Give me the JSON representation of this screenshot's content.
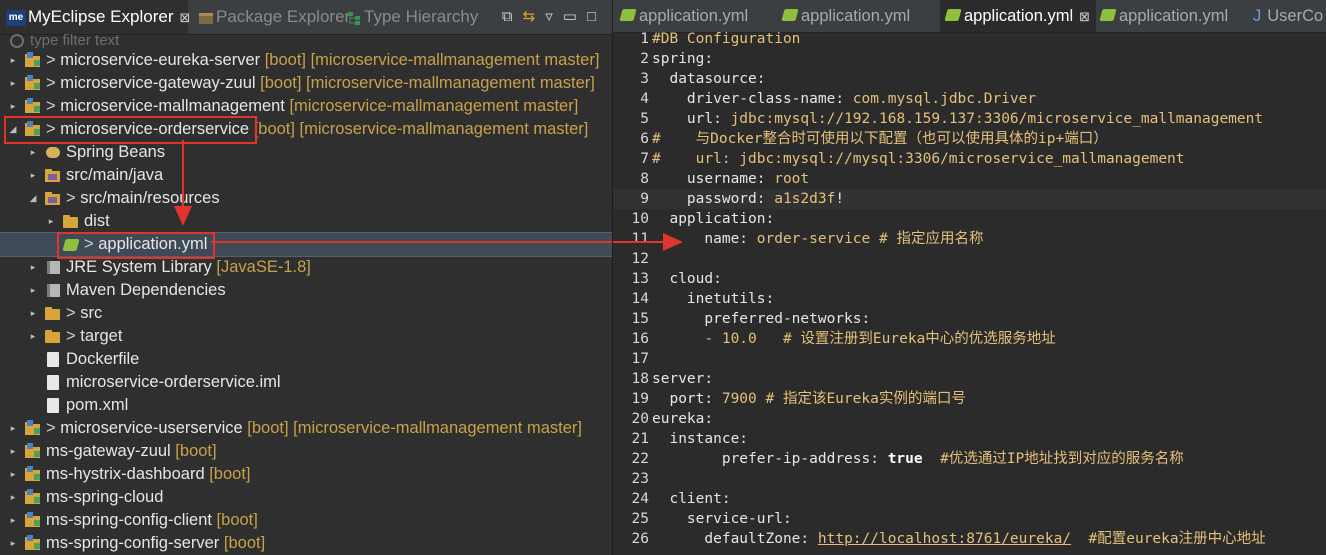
{
  "explorer": {
    "tabs": [
      {
        "label": "MyEclipse Explorer",
        "active": true,
        "icon": "myeclipse-icon",
        "close": "⊠"
      },
      {
        "label": "Package Explorer",
        "active": false,
        "icon": "package-icon"
      },
      {
        "label": "Type Hierarchy",
        "active": false,
        "icon": "hierarchy-icon"
      }
    ],
    "filter_placeholder": "type filter text",
    "rows": [
      {
        "indent": 0,
        "arrow": "▸",
        "icon": "project",
        "prefix": "> ",
        "label": "microservice-eureka-server",
        "deco": " [boot] [microservice-mallmanagement master]"
      },
      {
        "indent": 0,
        "arrow": "▸",
        "icon": "project",
        "prefix": "> ",
        "label": "microservice-gateway-zuul",
        "deco": " [boot] [microservice-mallmanagement master]"
      },
      {
        "indent": 0,
        "arrow": "▸",
        "icon": "project",
        "prefix": "> ",
        "label": "microservice-mallmanagement",
        "deco": " [microservice-mallmanagement master]"
      },
      {
        "indent": 0,
        "arrow": "◢",
        "icon": "project",
        "prefix": "> ",
        "label": "microservice-orderservice",
        "deco": " [boot] [microservice-mallmanagement master]"
      },
      {
        "indent": 1,
        "arrow": "▸",
        "icon": "bean",
        "prefix": "",
        "label": "Spring Beans",
        "deco": ""
      },
      {
        "indent": 1,
        "arrow": "▸",
        "icon": "package",
        "prefix": "",
        "label": "src/main/java",
        "deco": ""
      },
      {
        "indent": 1,
        "arrow": "◢",
        "icon": "package",
        "prefix": "> ",
        "label": "src/main/resources",
        "deco": ""
      },
      {
        "indent": 2,
        "arrow": "▸",
        "icon": "folder",
        "prefix": "",
        "label": "dist",
        "deco": ""
      },
      {
        "indent": 2,
        "arrow": "",
        "icon": "yml",
        "prefix": "> ",
        "label": "application.yml",
        "deco": "",
        "selected": true
      },
      {
        "indent": 1,
        "arrow": "▸",
        "icon": "library",
        "prefix": "",
        "label": "JRE System Library",
        "deco": " [JavaSE-1.8]"
      },
      {
        "indent": 1,
        "arrow": "▸",
        "icon": "library",
        "prefix": "",
        "label": "Maven Dependencies",
        "deco": ""
      },
      {
        "indent": 1,
        "arrow": "▸",
        "icon": "folder",
        "prefix": "> ",
        "label": "src",
        "deco": ""
      },
      {
        "indent": 1,
        "arrow": "▸",
        "icon": "folder",
        "prefix": "> ",
        "label": "target",
        "deco": ""
      },
      {
        "indent": 1,
        "arrow": "",
        "icon": "file",
        "prefix": "",
        "label": "Dockerfile",
        "deco": ""
      },
      {
        "indent": 1,
        "arrow": "",
        "icon": "file",
        "prefix": "",
        "label": "microservice-orderservice.iml",
        "deco": ""
      },
      {
        "indent": 1,
        "arrow": "",
        "icon": "file",
        "prefix": "",
        "label": "pom.xml",
        "deco": ""
      },
      {
        "indent": 0,
        "arrow": "▸",
        "icon": "project",
        "prefix": "> ",
        "label": "microservice-userservice",
        "deco": " [boot] [microservice-mallmanagement master]"
      },
      {
        "indent": 0,
        "arrow": "▸",
        "icon": "project",
        "prefix": "",
        "label": "ms-gateway-zuul",
        "deco": " [boot]"
      },
      {
        "indent": 0,
        "arrow": "▸",
        "icon": "project",
        "prefix": "",
        "label": "ms-hystrix-dashboard",
        "deco": " [boot]"
      },
      {
        "indent": 0,
        "arrow": "▸",
        "icon": "project",
        "prefix": "",
        "label": "ms-spring-cloud",
        "deco": ""
      },
      {
        "indent": 0,
        "arrow": "▸",
        "icon": "project",
        "prefix": "",
        "label": "ms-spring-config-client",
        "deco": " [boot]"
      },
      {
        "indent": 0,
        "arrow": "▸",
        "icon": "project",
        "prefix": "",
        "label": "ms-spring-config-server",
        "deco": " [boot]"
      }
    ]
  },
  "editor": {
    "tabs": [
      {
        "label": "application.yml",
        "active": false
      },
      {
        "label": "application.yml",
        "active": false
      },
      {
        "label": "application.yml",
        "active": true,
        "close": "⊠"
      },
      {
        "label": "application.yml",
        "active": false
      },
      {
        "label": "UserCo",
        "active": false,
        "java": true
      }
    ],
    "lines": [
      {
        "n": "1",
        "parts": [
          [
            "#DB Configuration",
            "c"
          ]
        ]
      },
      {
        "n": "2",
        "parts": [
          [
            "spring:",
            "k"
          ]
        ]
      },
      {
        "n": "3",
        "parts": [
          [
            "  datasource:",
            "k"
          ]
        ]
      },
      {
        "n": "4",
        "parts": [
          [
            "    driver-class-name: ",
            "k"
          ],
          [
            "com.mysql.jdbc.Driver",
            "v"
          ]
        ]
      },
      {
        "n": "5",
        "parts": [
          [
            "    url: ",
            "k"
          ],
          [
            "jdbc:mysql://192.168.159.137:3306/microservice_mallmanagement",
            "v"
          ]
        ]
      },
      {
        "n": "6",
        "parts": [
          [
            "#    与Docker整合时可使用以下配置（也可以使用具体的ip+端口）",
            "c"
          ]
        ]
      },
      {
        "n": "7",
        "parts": [
          [
            "#    url: jdbc:mysql://mysql:3306/microservice_mallmanagement",
            "c"
          ]
        ]
      },
      {
        "n": "8",
        "parts": [
          [
            "    username: ",
            "k"
          ],
          [
            "root",
            "v"
          ]
        ]
      },
      {
        "n": "9",
        "parts": [
          [
            "    password: ",
            "k"
          ],
          [
            "a1s2d3f",
            "v"
          ],
          [
            "!",
            "k"
          ]
        ],
        "highlight": true
      },
      {
        "n": "10",
        "parts": [
          [
            "  application:",
            "k"
          ]
        ]
      },
      {
        "n": "11",
        "parts": [
          [
            "      name: ",
            "k"
          ],
          [
            "order-service",
            "v"
          ],
          [
            " # 指定应用名称",
            "c"
          ]
        ]
      },
      {
        "n": "12",
        "parts": [
          [
            "",
            "k"
          ]
        ]
      },
      {
        "n": "13",
        "parts": [
          [
            "  cloud:",
            "k"
          ]
        ]
      },
      {
        "n": "14",
        "parts": [
          [
            "    inetutils:",
            "k"
          ]
        ]
      },
      {
        "n": "15",
        "parts": [
          [
            "      preferred-networks:",
            "k"
          ]
        ]
      },
      {
        "n": "16",
        "parts": [
          [
            "      - ",
            "v"
          ],
          [
            "10.0",
            "v"
          ],
          [
            "   # 设置注册到Eureka中心的优选服务地址",
            "c"
          ]
        ]
      },
      {
        "n": "17",
        "parts": [
          [
            "",
            "k"
          ]
        ]
      },
      {
        "n": "18",
        "parts": [
          [
            "server:",
            "k"
          ]
        ]
      },
      {
        "n": "19",
        "parts": [
          [
            "  port: ",
            "k"
          ],
          [
            "7900",
            "v"
          ],
          [
            " # 指定该Eureka实例的端口号",
            "c"
          ]
        ]
      },
      {
        "n": "20",
        "parts": [
          [
            "eureka:",
            "k"
          ]
        ]
      },
      {
        "n": "21",
        "parts": [
          [
            "  instance:",
            "k"
          ]
        ]
      },
      {
        "n": "22",
        "parts": [
          [
            "        prefer-ip-address: ",
            "k"
          ],
          [
            "true",
            "kw"
          ],
          [
            "  #优选通过IP地址找到对应的服务名称",
            "c"
          ]
        ]
      },
      {
        "n": "23",
        "parts": [
          [
            "",
            "k"
          ]
        ]
      },
      {
        "n": "24",
        "parts": [
          [
            "  client:",
            "k"
          ]
        ]
      },
      {
        "n": "25",
        "parts": [
          [
            "    service-url:",
            "k"
          ]
        ]
      },
      {
        "n": "26",
        "parts": [
          [
            "      defaultZone: ",
            "k"
          ],
          [
            "http://localhost:8761/eureka/",
            "url"
          ],
          [
            "  #配置eureka注册中心地址",
            "c"
          ]
        ]
      }
    ]
  },
  "colors": {
    "annotation": "#e0342c",
    "yaml_value": "#e5c07b",
    "deco": "#c8a24a"
  }
}
